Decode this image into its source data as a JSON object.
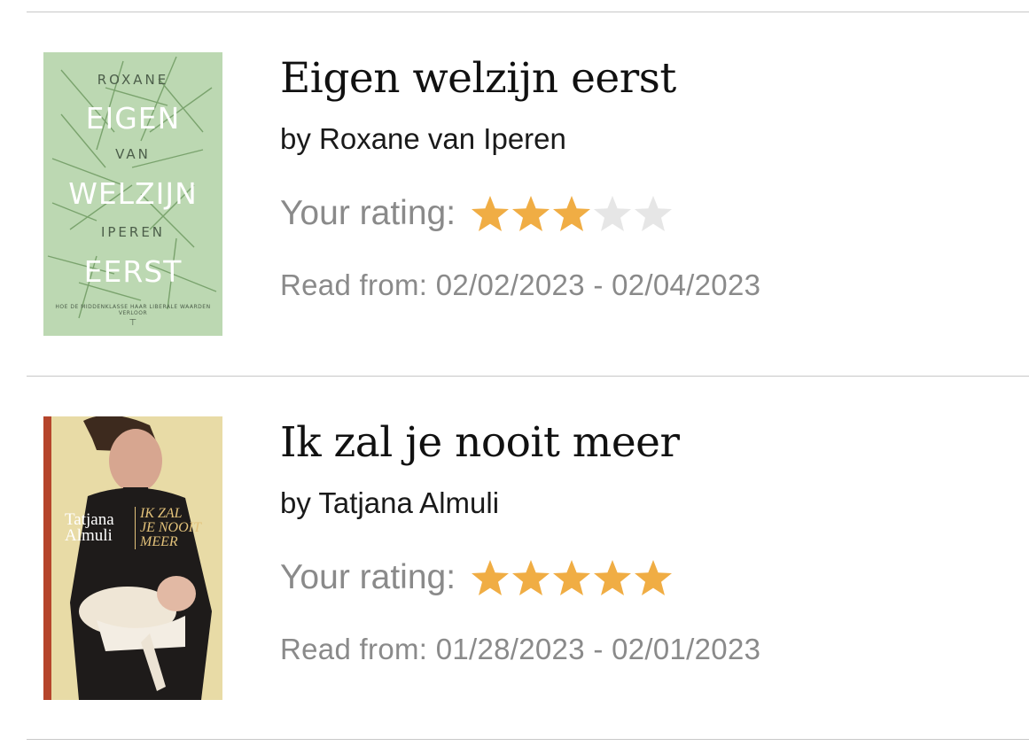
{
  "books": [
    {
      "title": "Eigen welzijn eerst",
      "author": "by Roxane van Iperen",
      "rating_label": "Your rating:",
      "rating": 3,
      "rating_max": 5,
      "read_dates": "Read from: 02/02/2023 - 02/04/2023",
      "cover": {
        "line1": "ROXANE",
        "line2": "EIGEN",
        "line3": "VAN",
        "line4": "WELZIJN",
        "line5": "IPEREN",
        "line6": "EERST",
        "subtitle": "HOE DE MIDDENKLASSE HAAR LIBERALE WAARDEN VERLOOR",
        "bg_color": "#bcd8b2"
      }
    },
    {
      "title": "Ik zal je nooit meer",
      "author": "by Tatjana Almuli",
      "rating_label": "Your rating:",
      "rating": 5,
      "rating_max": 5,
      "read_dates": "Read from: 01/28/2023 - 02/01/2023",
      "cover": {
        "author_first": "Tatjana",
        "author_last": "Almuli",
        "title_l1": "IK ZAL",
        "title_l2": "JE NOOIT",
        "title_l3": "MEER",
        "bg_color": "#e7d9a4",
        "spine_color": "#b5452b"
      }
    }
  ],
  "colors": {
    "star_filled": "#f0ad44",
    "star_empty": "#e6e6e6",
    "divider": "#c8c8c8",
    "muted_text": "#8a8a8a"
  }
}
